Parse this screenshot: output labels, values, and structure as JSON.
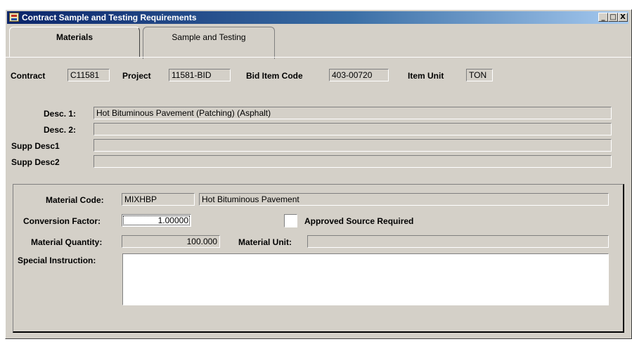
{
  "window": {
    "title": "Contract Sample and Testing Requirements",
    "minimize": "_",
    "maximize": "□",
    "close": "X"
  },
  "tabs": [
    {
      "label": "Materials",
      "active": true
    },
    {
      "label": "Sample and Testing",
      "active": false
    }
  ],
  "header": {
    "contract_label": "Contract",
    "contract_value": "C11581",
    "project_label": "Project",
    "project_value": "11581-BID",
    "bid_item_label": "Bid Item Code",
    "bid_item_value": "403-00720",
    "item_unit_label": "Item Unit",
    "item_unit_value": "TON"
  },
  "descriptions": {
    "desc1_label": "Desc. 1:",
    "desc1_value": "Hot Bituminous Pavement (Patching) (Asphalt)",
    "desc2_label": "Desc. 2:",
    "desc2_value": "",
    "supp1_label": "Supp Desc1",
    "supp1_value": "",
    "supp2_label": "Supp Desc2",
    "supp2_value": ""
  },
  "material": {
    "code_label": "Material Code:",
    "code_value": "MIXHBP",
    "code_desc": "Hot Bituminous Pavement",
    "conversion_label": "Conversion Factor:",
    "conversion_value": "1.00000",
    "approved_label": "Approved Source Required",
    "approved_checked": false,
    "quantity_label": "Material Quantity:",
    "quantity_value": "100.000",
    "unit_label": "Material Unit:",
    "unit_value": "",
    "special_label": "Special Instruction:",
    "special_value": ""
  }
}
